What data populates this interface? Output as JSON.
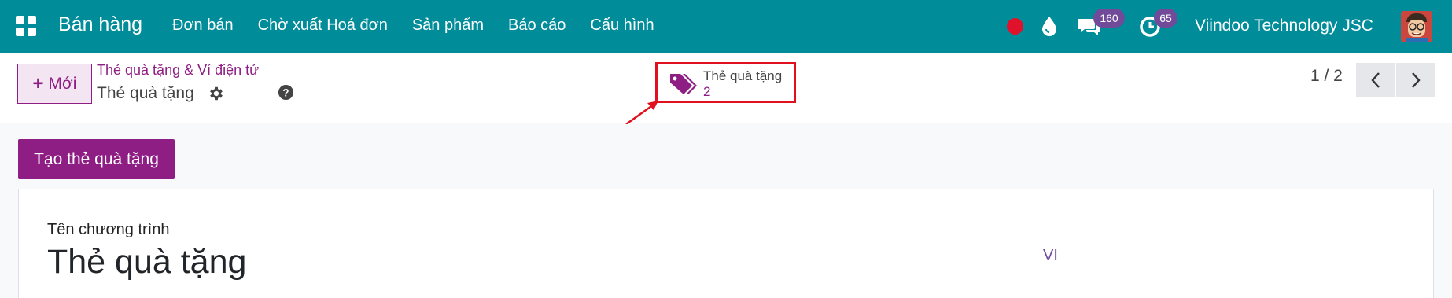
{
  "navbar": {
    "app_name": "Bán hàng",
    "menu": [
      "Đơn bán",
      "Chờ xuất Hoá đơn",
      "Sản phẩm",
      "Báo cáo",
      "Cấu hình"
    ],
    "messages_count": "160",
    "activities_count": "65",
    "company": "Viindoo Technology JSC",
    "icons": [
      "apps-grid-icon",
      "recording-dot-icon",
      "water-drop-icon",
      "chat-icon",
      "clock-activity-icon",
      "user-avatar"
    ],
    "colors": {
      "bar": "#018c9a",
      "badge": "#714b99",
      "record_dot": "#e0112b"
    }
  },
  "control_panel": {
    "new_label": "Mới",
    "breadcrumb_parent": "Thẻ quà tặng & Ví điện tử",
    "record_title": "Thẻ quà tặng",
    "smart_button": {
      "label": "Thẻ quà tặng",
      "count": "2",
      "icon": "tags-icon",
      "highlight_color": "#e0101e"
    },
    "pager": "1 / 2"
  },
  "main": {
    "create_button_label": "Tạo thẻ quà tặng",
    "field_label": "Tên chương trình",
    "program_name": "Thẻ quà tặng",
    "lang": "VI"
  },
  "accent_color": "#8e1d84"
}
